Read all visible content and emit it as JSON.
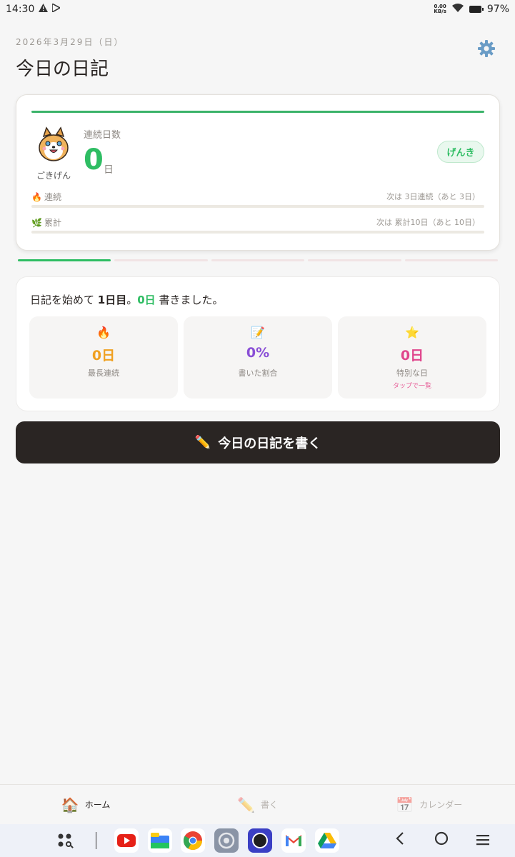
{
  "status_bar": {
    "time": "14:30",
    "net_speed_value": "0.00",
    "net_speed_unit": "KB/s",
    "battery": "97%"
  },
  "header": {
    "date": "2026年3月29日（日）",
    "title": "今日の日記"
  },
  "streak_card": {
    "mood_label": "ごきげん",
    "streak_label": "連続日数",
    "streak_value": "0",
    "streak_unit": "日",
    "status_badge": "げんき",
    "progress": [
      {
        "icon": "🔥",
        "label": "連続",
        "next": "次は 3日連続（あと 3日）",
        "fraction": 0
      },
      {
        "icon": "🌿",
        "label": "累計",
        "next": "次は 累計10日（あと 10日）",
        "fraction": 0
      }
    ],
    "accent_color": "#2ebd63"
  },
  "pager": {
    "count": 5,
    "active_index": 0
  },
  "summary": {
    "prefix": "日記を始めて ",
    "day_count": "1日目",
    "mid": "。",
    "written_count": "0日",
    "suffix": " 書きました。",
    "stats": [
      {
        "emoji": "🔥",
        "value": "0日",
        "caption": "最長連続",
        "color": "#f0a020",
        "sub": ""
      },
      {
        "emoji": "📝",
        "value": "0%",
        "caption": "書いた割合",
        "color": "#8a4fd6",
        "sub": ""
      },
      {
        "emoji": "⭐",
        "value": "0日",
        "caption": "特別な日",
        "color": "#e0458c",
        "sub": "タップで一覧"
      }
    ]
  },
  "write_button": {
    "icon": "✏️",
    "label": "今日の日記を書く"
  },
  "bottom_nav": [
    {
      "icon": "🏠",
      "label": "ホーム",
      "active": true
    },
    {
      "icon": "✏️",
      "label": "書く",
      "active": false
    },
    {
      "icon": "📅",
      "label": "カレンダー",
      "active": false
    }
  ],
  "system_bar": {
    "apps": [
      "app-drawer",
      "youtube",
      "files",
      "chrome",
      "settings",
      "camera",
      "gmail",
      "drive"
    ]
  }
}
